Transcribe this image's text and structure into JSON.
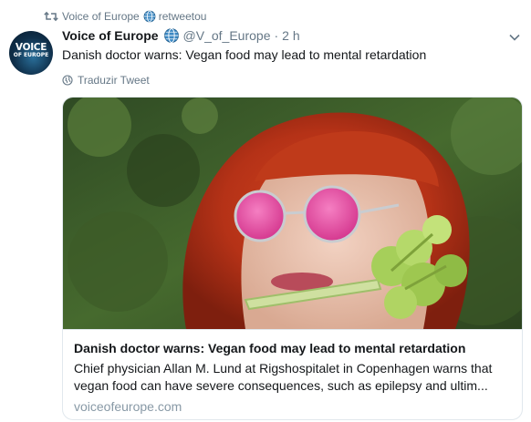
{
  "retweet": {
    "icon": "retweet-icon",
    "by": "Voice of Europe",
    "globe_icon": "globe-icon",
    "label": "retweetou"
  },
  "author": {
    "avatar_text": "VOICE",
    "avatar_subtext": "OF EUROPE",
    "name": "Voice of Europe",
    "badge_icon": "globe-icon",
    "handle": "@V_of_Europe",
    "separator": "·",
    "time": "2 h"
  },
  "tweet": {
    "text": "Danish doctor warns: Vegan food may lead to mental retardation",
    "translate_label": "Traduzir Tweet",
    "translate_icon": "globe-icon",
    "menu_icon": "chevron-down-icon"
  },
  "card": {
    "image_description_icon": "article-photo",
    "title": "Danish doctor warns: Vegan food may lead to mental retardation",
    "description": "Chief physician Allan M. Lund at Rigshospitalet in Copenhagen warns that vegan food can have severe consequences, such as epilepsy and ultim...",
    "domain": "voiceofeurope.com"
  },
  "colors": {
    "text_primary": "#14171a",
    "text_secondary": "#657786",
    "border": "#e1e8ed",
    "domain": "#8899a6"
  }
}
